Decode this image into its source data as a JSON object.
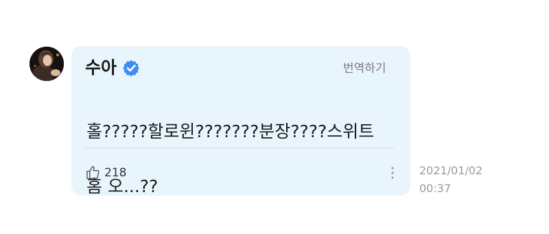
{
  "comment": {
    "author": "수아",
    "verified_icon": "verified-badge-icon",
    "translate_label": "번역하기",
    "message_line1": "홀?????할로윈???????분장????스위트",
    "message_line2": "홈 오...??",
    "likes": "218",
    "like_icon": "thumbs-up-icon",
    "more_icon": "more-vertical-icon",
    "date": "2021/01/02",
    "time": "00:37"
  },
  "colors": {
    "bubble_bg": "#e9f5fd",
    "verified_blue": "#3d8ef0",
    "text_primary": "#1a1a1a",
    "text_muted": "#9a9a9a"
  }
}
